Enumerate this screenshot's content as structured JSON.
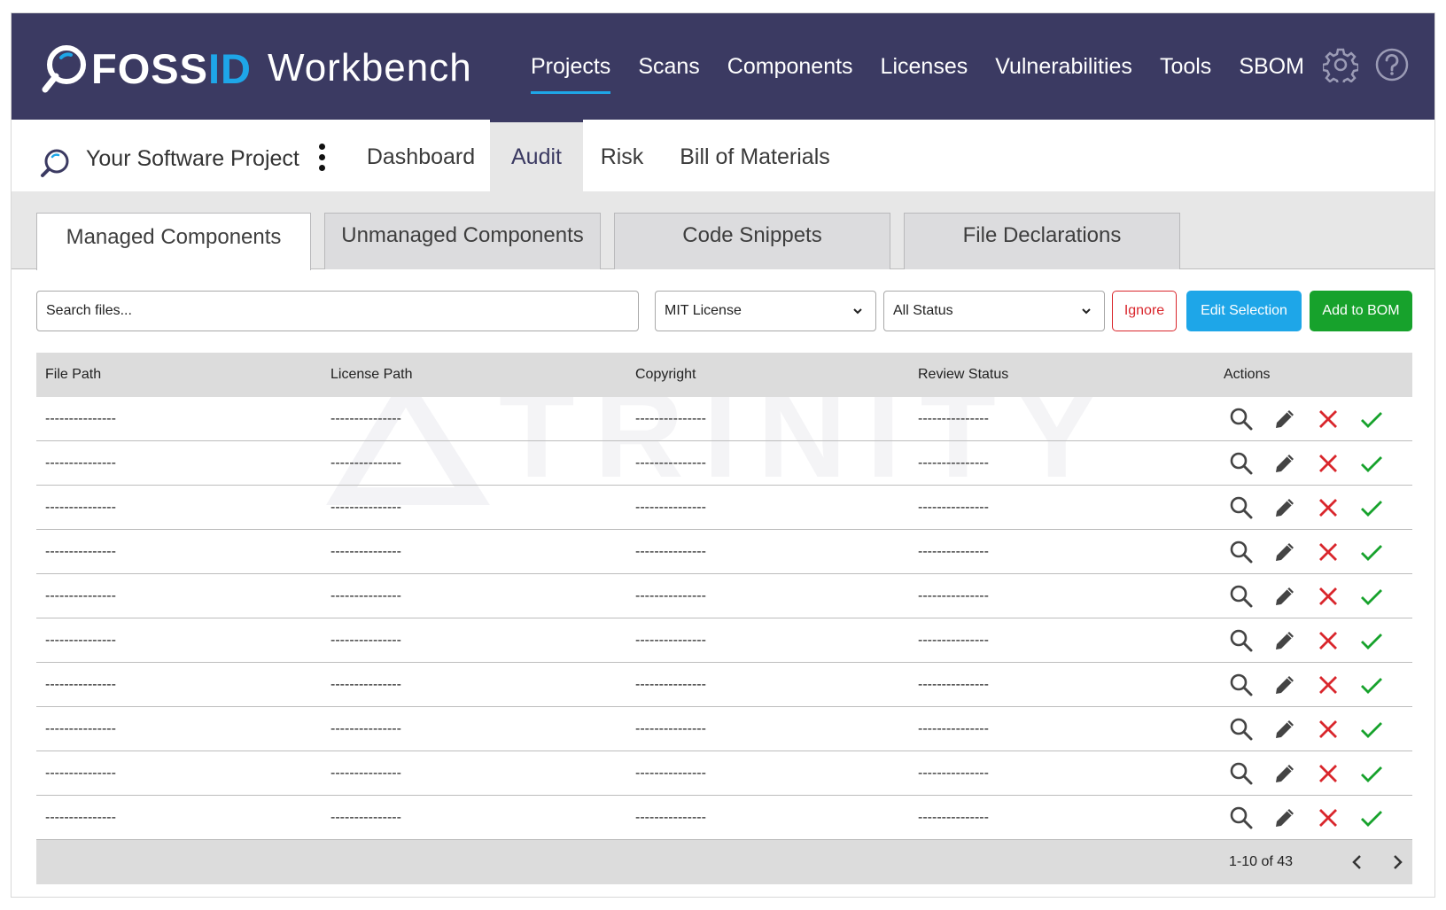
{
  "brand": {
    "name_part1": "FOSS",
    "name_part2": "ID",
    "product": "Workbench"
  },
  "main_nav": [
    {
      "label": "Projects",
      "active": true
    },
    {
      "label": "Scans",
      "active": false
    },
    {
      "label": "Components",
      "active": false
    },
    {
      "label": "Licenses",
      "active": false
    },
    {
      "label": "Vulnerabilities",
      "active": false
    },
    {
      "label": "Tools",
      "active": false
    },
    {
      "label": "SBOM",
      "active": false
    }
  ],
  "header_icons": [
    "gear-icon",
    "help-icon"
  ],
  "project": {
    "name": "Your Software Project",
    "tabs": [
      {
        "label": "Dashboard",
        "active": false
      },
      {
        "label": "Audit",
        "active": true
      },
      {
        "label": "Risk",
        "active": false
      },
      {
        "label": "Bill of Materials",
        "active": false
      }
    ]
  },
  "sub_tabs": [
    {
      "label": "Managed Components",
      "active": true
    },
    {
      "label": "Unmanaged Components",
      "active": false
    },
    {
      "label": "Code Snippets",
      "active": false
    },
    {
      "label": "File Declarations",
      "active": false
    }
  ],
  "toolbar": {
    "search_placeholder": "Search files...",
    "license_filter": "MIT License",
    "status_filter": "All Status",
    "ignore_label": "Ignore",
    "edit_label": "Edit Selection",
    "add_bom_label": "Add to BOM"
  },
  "table": {
    "columns": [
      "File Path",
      "License Path",
      "Copyright",
      "Review Status",
      "Actions"
    ],
    "rows": [
      [
        "---------------",
        "---------------",
        "---------------",
        "---------------"
      ],
      [
        "---------------",
        "---------------",
        "---------------",
        "---------------"
      ],
      [
        "---------------",
        "---------------",
        "---------------",
        "---------------"
      ],
      [
        "---------------",
        "---------------",
        "---------------",
        "---------------"
      ],
      [
        "---------------",
        "---------------",
        "---------------",
        "---------------"
      ],
      [
        "---------------",
        "---------------",
        "---------------",
        "---------------"
      ],
      [
        "---------------",
        "---------------",
        "---------------",
        "---------------"
      ],
      [
        "---------------",
        "---------------",
        "---------------",
        "---------------"
      ],
      [
        "---------------",
        "---------------",
        "---------------",
        "---------------"
      ],
      [
        "---------------",
        "---------------",
        "---------------",
        "---------------"
      ]
    ],
    "row_actions": [
      "search-icon",
      "pencil-icon",
      "close-icon",
      "check-icon"
    ],
    "pagination": "1-10 of 43"
  },
  "watermark": {
    "text": "TRINITY"
  },
  "colors": {
    "header_bg": "#3b3a62",
    "accent_blue": "#1ea6e8",
    "danger_red": "#d9262c",
    "success_green": "#17a22c"
  }
}
